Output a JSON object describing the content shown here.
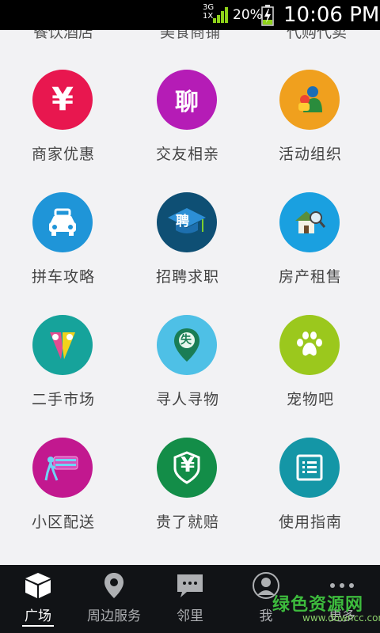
{
  "status_bar": {
    "network": "3G",
    "network2": "1X",
    "battery_percent": "20%",
    "time": "10:06 PM"
  },
  "partial_row": [
    "餐饮酒店",
    "美食商铺",
    "代购代卖"
  ],
  "grid": [
    {
      "label": "商家优惠",
      "icon": "yen-icon",
      "color": "#e8174f",
      "glyph": "¥"
    },
    {
      "label": "交友相亲",
      "icon": "chat-icon",
      "color": "#b51cb6",
      "glyph": "聊"
    },
    {
      "label": "活动组织",
      "icon": "activity-icon",
      "color": "#f0a01e",
      "glyph": ""
    },
    {
      "label": "拼车攻略",
      "icon": "car-icon",
      "color": "#1f95d8",
      "glyph": ""
    },
    {
      "label": "招聘求职",
      "icon": "recruit-icon",
      "color": "#0e4f74",
      "glyph": "聘"
    },
    {
      "label": "房产租售",
      "icon": "house-icon",
      "color": "#1aa0e0",
      "glyph": ""
    },
    {
      "label": "二手市场",
      "icon": "market-icon",
      "color": "#16a39b",
      "glyph": ""
    },
    {
      "label": "寻人寻物",
      "icon": "search-pin-icon",
      "color": "#4ec0e6",
      "glyph": "失"
    },
    {
      "label": "宠物吧",
      "icon": "paw-icon",
      "color": "#9bc81d",
      "glyph": ""
    },
    {
      "label": "小区配送",
      "icon": "delivery-icon",
      "color": "#c2188f",
      "glyph": ""
    },
    {
      "label": "贵了就赔",
      "icon": "compensation-icon",
      "color": "#138d48",
      "glyph": "¥"
    },
    {
      "label": "使用指南",
      "icon": "guide-icon",
      "color": "#1496a6",
      "glyph": ""
    }
  ],
  "tabs": [
    {
      "label": "广场",
      "icon": "cube-icon",
      "active": true
    },
    {
      "label": "周边服务",
      "icon": "location-pin-icon",
      "active": false
    },
    {
      "label": "邻里",
      "icon": "message-icon",
      "active": false
    },
    {
      "label": "我",
      "icon": "user-icon",
      "active": false
    },
    {
      "label": "更多",
      "icon": "more-icon",
      "active": false
    }
  ],
  "watermark": {
    "cn": "绿色资源网",
    "en": "www.downcc.com"
  }
}
